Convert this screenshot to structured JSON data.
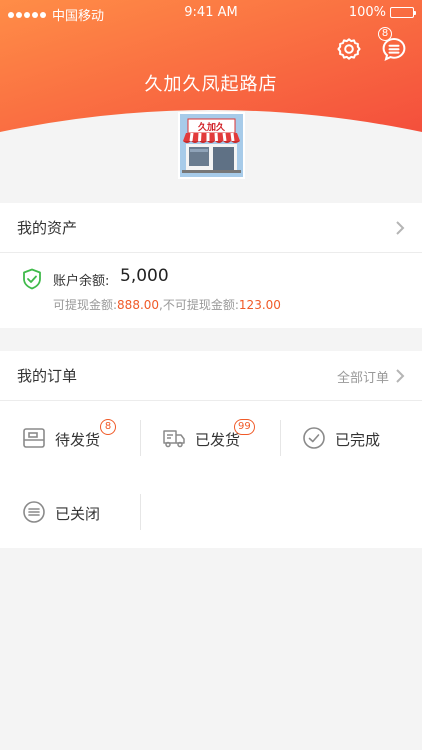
{
  "status_bar": {
    "carrier": "中国移动",
    "time": "9:41 AM",
    "battery": "100%"
  },
  "header": {
    "store_name": "久加久凤起路店",
    "logo_text": "久加久",
    "message_badge": "8"
  },
  "assets": {
    "title": "我的资产",
    "balance_label": "账户余额:",
    "balance_value": "5,000",
    "withdrawable_label": "可提现金额:",
    "withdrawable_value": "888.00",
    "separator": ",",
    "non_withdrawable_label": "不可提现金额:",
    "non_withdrawable_value": "123.00"
  },
  "orders": {
    "title": "我的订单",
    "all_label": "全部订单",
    "items": [
      {
        "label": "待发货",
        "badge": "8",
        "icon": "box-icon"
      },
      {
        "label": "已发货",
        "badge": "99",
        "icon": "truck-icon"
      },
      {
        "label": "已完成",
        "badge": "",
        "icon": "check-circle-icon"
      },
      {
        "label": "已关闭",
        "badge": "",
        "icon": "closed-list-icon"
      }
    ]
  },
  "colors": {
    "header_start": "#ff8c42",
    "header_end": "#f5533d",
    "accent": "#f05a28"
  }
}
